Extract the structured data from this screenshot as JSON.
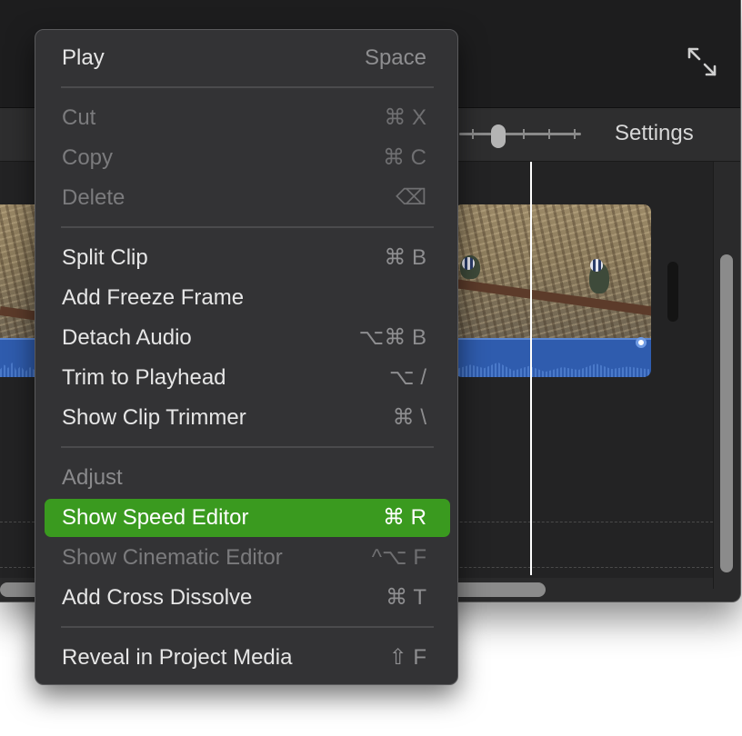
{
  "toolbar": {
    "settings_label": "Settings"
  },
  "icons": {
    "fullscreen": "expand-arrows-icon",
    "delete_key": "delete-key-icon"
  },
  "colors": {
    "menu_highlight": "#3a9a1f",
    "audio_track": "#2f5cae",
    "menu_background": "#333335"
  },
  "menu": {
    "play": {
      "label": "Play",
      "shortcut": "Space"
    },
    "cut": {
      "label": "Cut",
      "shortcut": "⌘ X"
    },
    "copy": {
      "label": "Copy",
      "shortcut": "⌘ C"
    },
    "delete": {
      "label": "Delete",
      "shortcut": "⌫"
    },
    "split_clip": {
      "label": "Split Clip",
      "shortcut": "⌘ B"
    },
    "add_freeze_frame": {
      "label": "Add Freeze Frame",
      "shortcut": ""
    },
    "detach_audio": {
      "label": "Detach Audio",
      "shortcut": "⌥⌘ B"
    },
    "trim_to_playhead": {
      "label": "Trim to Playhead",
      "shortcut": "⌥ /"
    },
    "show_clip_trimmer": {
      "label": "Show Clip Trimmer",
      "shortcut": "⌘ \\"
    },
    "adjust": {
      "label": "Adjust"
    },
    "show_speed_editor": {
      "label": "Show Speed Editor",
      "shortcut": "⌘ R"
    },
    "show_cinematic_editor": {
      "label": "Show Cinematic Editor",
      "shortcut": "^⌥ F"
    },
    "add_cross_dissolve": {
      "label": "Add Cross Dissolve",
      "shortcut": "⌘ T"
    },
    "reveal_in_project_media": {
      "label": "Reveal in Project Media",
      "shortcut": "⇧ F"
    }
  }
}
